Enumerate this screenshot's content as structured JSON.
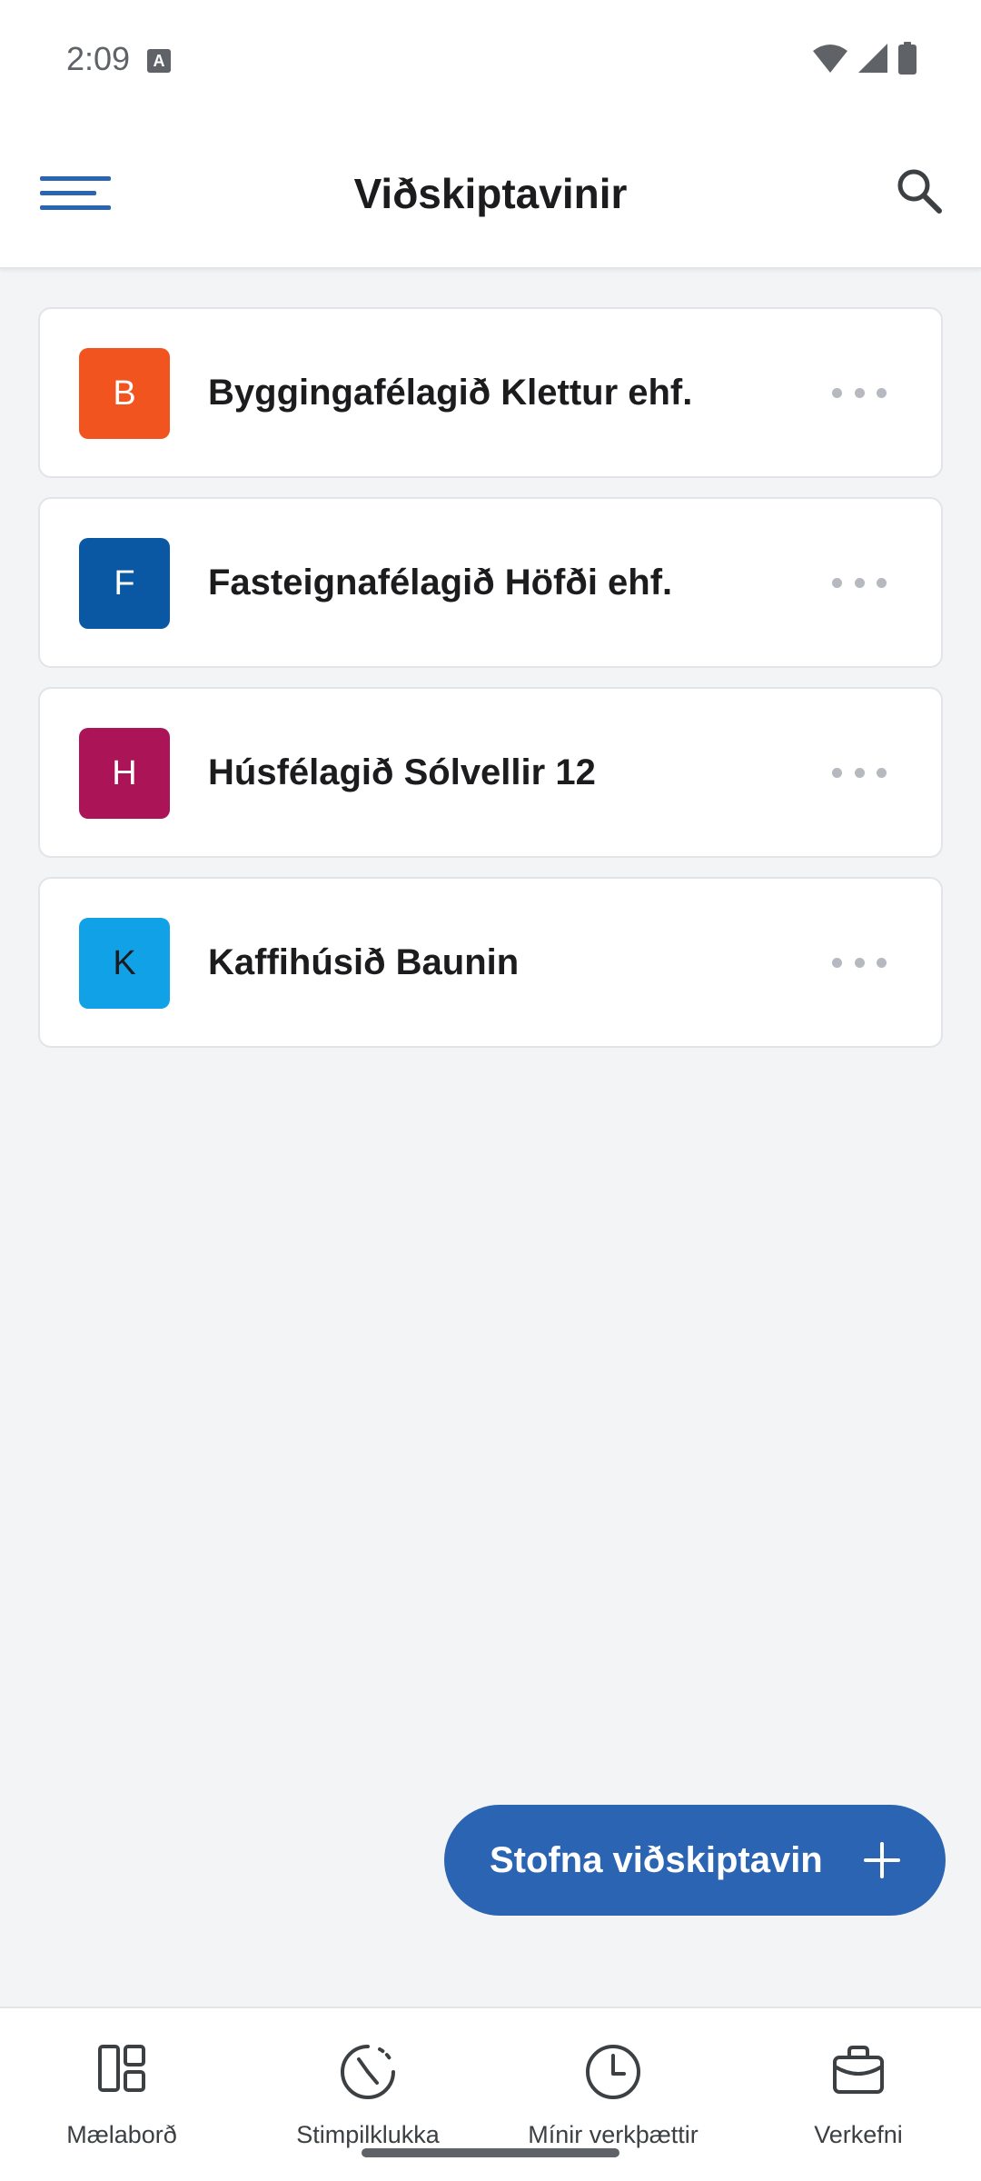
{
  "status_bar": {
    "time": "2:09",
    "notification_icon": "a-notification-icon",
    "wifi_icon": "wifi-icon",
    "signal_icon": "signal-icon",
    "battery_icon": "battery-icon"
  },
  "app_bar": {
    "title": "Viðskiptavinir",
    "menu_icon": "hamburger-menu-icon",
    "search_icon": "search-icon"
  },
  "customers": [
    {
      "initial": "B",
      "name": "Byggingafélagið Klettur ehf.",
      "color": "#f2541f"
    },
    {
      "initial": "F",
      "name": "Fasteignafélagið Höfði ehf.",
      "color": "#0a57a3"
    },
    {
      "initial": "H",
      "name": "Húsfélagið Sólvellir 12",
      "color": "#ac1458"
    },
    {
      "initial": "K",
      "name": "Kaffihúsið Baunin",
      "color": "#10a1e6"
    }
  ],
  "fab": {
    "label": "Stofna viðskiptavin",
    "icon": "plus-icon",
    "color": "#2b64b3"
  },
  "bottom_nav": [
    {
      "label": "Mælaborð",
      "icon": "dashboard-icon"
    },
    {
      "label": "Stimpilklukka",
      "icon": "punch-clock-icon"
    },
    {
      "label": "Mínir verkþættir",
      "icon": "clock-icon"
    },
    {
      "label": "Verkefni",
      "icon": "briefcase-icon"
    }
  ],
  "colors": {
    "accent": "#2b64b3",
    "background": "#f3f4f6"
  }
}
